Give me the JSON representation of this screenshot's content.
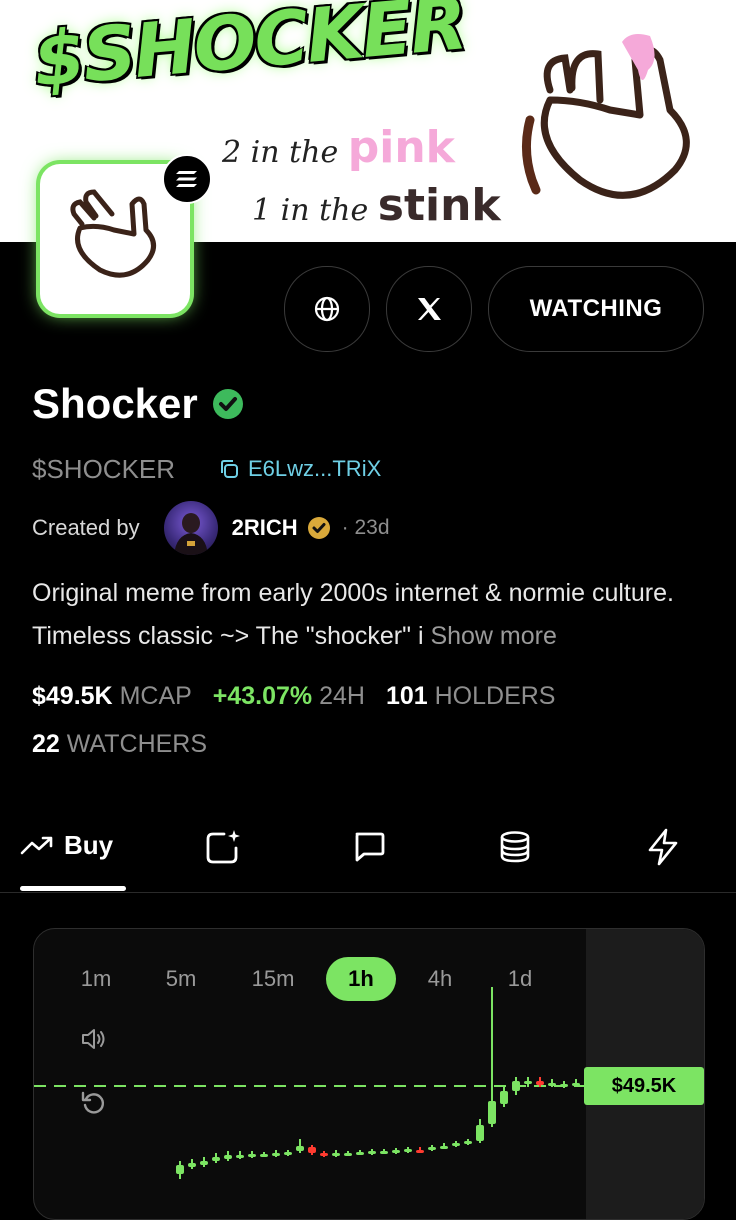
{
  "banner": {
    "title": "$SHOCKER",
    "line1_prefix": "2 in the",
    "line1_word": "pink",
    "line2_prefix": "1 in the",
    "line2_word": "stink"
  },
  "actions": {
    "watching_label": "WATCHING"
  },
  "token": {
    "name": "Shocker",
    "ticker": "$SHOCKER",
    "address": "E6Lwz...TRiX"
  },
  "creator": {
    "label": "Created by",
    "name": "2RICH",
    "age": "· 23d"
  },
  "description": {
    "text": "Original meme from early 2000s internet & normie culture. Timeless classic ~> The \"shocker\" i",
    "more": "Show more"
  },
  "stats": {
    "mcap_value": "$49.5K",
    "mcap_label": "MCAP",
    "change_value": "+43.07%",
    "change_label": "24H",
    "holders_value": "101",
    "holders_label": "HOLDERS",
    "watchers_value": "22",
    "watchers_label": "WATCHERS"
  },
  "tabs": {
    "buy_label": "Buy"
  },
  "chart": {
    "timeframes": [
      "1m",
      "5m",
      "15m",
      "1h",
      "4h",
      "1d"
    ],
    "active_timeframe": "1h",
    "price_label": "$49.5K",
    "colors": {
      "up": "#7ce463",
      "down": "#ff3b30"
    }
  }
}
